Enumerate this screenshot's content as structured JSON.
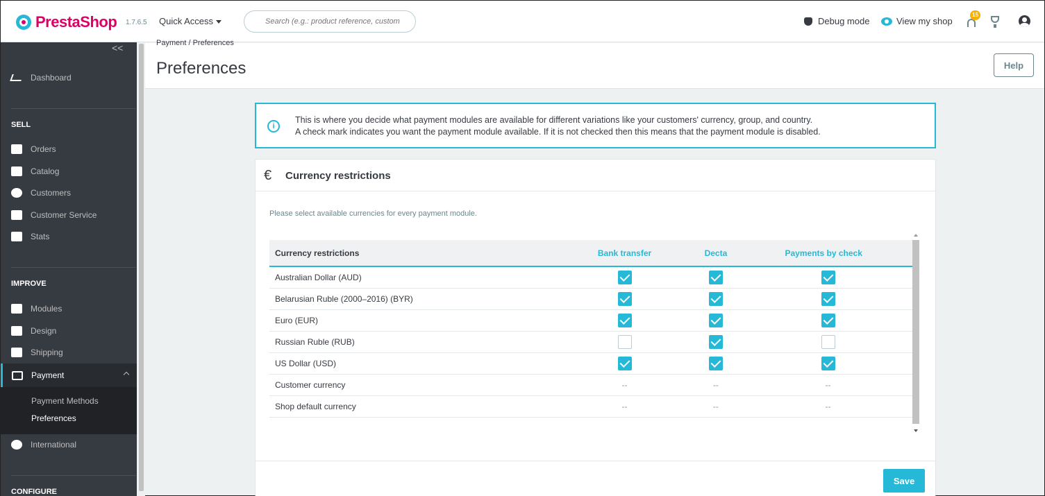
{
  "header": {
    "brand": "PrestaShop",
    "version": "1.7.6.5",
    "quick_access": "Quick Access",
    "search_placeholder": "Search (e.g.: product reference, custom",
    "debug_mode": "Debug mode",
    "view_shop": "View my shop",
    "notifications_count": "15"
  },
  "sidebar": {
    "dashboard": "Dashboard",
    "sell_section": "SELL",
    "sell_items": [
      "Orders",
      "Catalog",
      "Customers",
      "Customer Service",
      "Stats"
    ],
    "improve_section": "IMPROVE",
    "improve_items": [
      "Modules",
      "Design",
      "Shipping"
    ],
    "payment": "Payment",
    "payment_sub": [
      "Payment Methods",
      "Preferences"
    ],
    "international": "International",
    "configure_section": "CONFIGURE"
  },
  "page": {
    "breadcrumb": "Payment /  Preferences",
    "title": "Preferences",
    "help": "Help"
  },
  "alert": {
    "line1": "This is where you decide what payment modules are available for different variations like your customers' currency, group, and country.",
    "line2": "A check mark indicates you want the payment module available. If it is not checked then this means that the payment module is disabled."
  },
  "panel": {
    "icon": "€",
    "title": "Currency restrictions",
    "description": "Please select available currencies for every payment module.",
    "save": "Save"
  },
  "table": {
    "headers": [
      "Currency restrictions",
      "Bank transfer",
      "Decta",
      "Payments by check"
    ],
    "rows": [
      {
        "name": "Australian Dollar (AUD)",
        "values": [
          true,
          true,
          true
        ]
      },
      {
        "name": "Belarusian Ruble (2000–2016) (BYR)",
        "values": [
          true,
          true,
          true
        ]
      },
      {
        "name": "Euro (EUR)",
        "values": [
          true,
          true,
          true
        ]
      },
      {
        "name": "Russian Ruble (RUB)",
        "values": [
          false,
          true,
          false
        ]
      },
      {
        "name": "US Dollar (USD)",
        "values": [
          true,
          true,
          true
        ]
      },
      {
        "name": "Customer currency",
        "values": [
          "--",
          "--",
          "--"
        ]
      },
      {
        "name": "Shop default currency",
        "values": [
          "--",
          "--",
          "--"
        ]
      }
    ]
  },
  "colors": {
    "accent": "#25b9d7",
    "brand": "#df0067",
    "sidebar": "#363a41"
  }
}
